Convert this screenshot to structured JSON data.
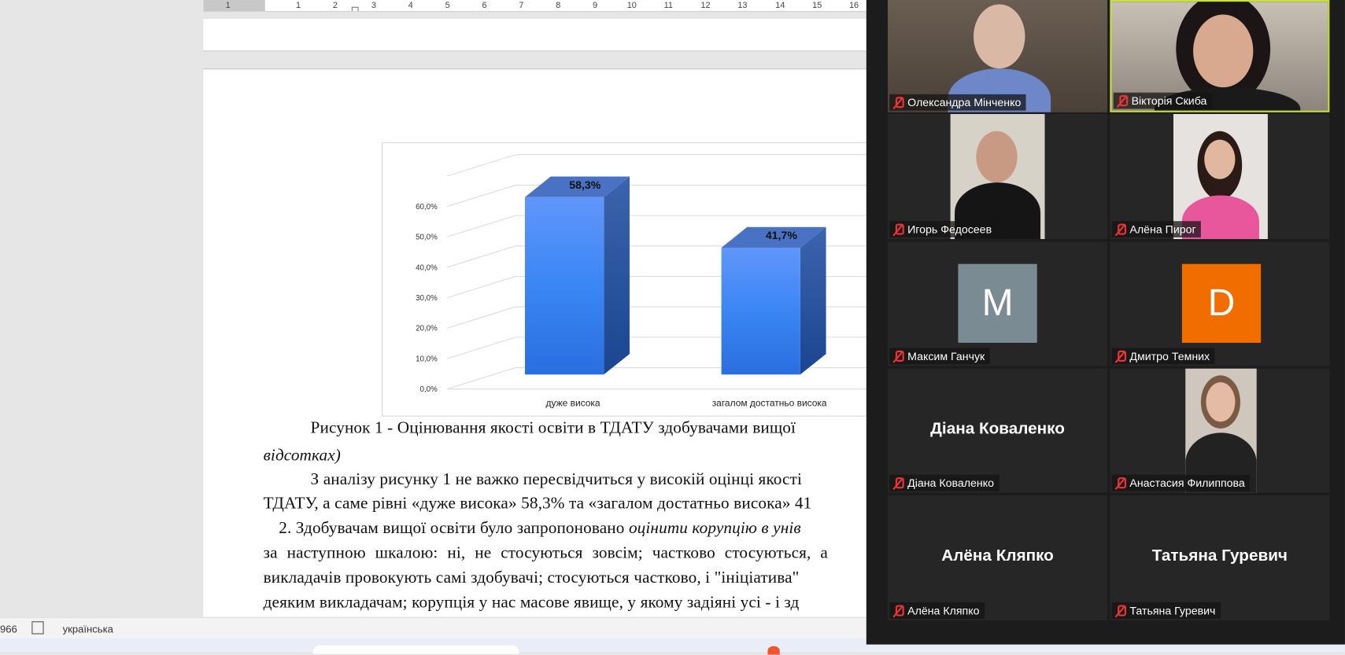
{
  "ruler": {
    "ticks": [
      "1",
      "1",
      "2",
      "3",
      "4",
      "5",
      "6",
      "7",
      "8",
      "9",
      "10",
      "11",
      "12",
      "13",
      "14",
      "15",
      "16"
    ]
  },
  "document": {
    "caption_line1": "Рисунок 1 - Оцінювання якості освіти в ТДАТУ здобувачами вищої",
    "caption_line2": "відсотках)",
    "para1_line1": "З аналізу рисунку 1 не важко пересвідчиться у високій оцінці якості",
    "para1_line2": "ТДАТУ, а саме рівні «дуже висока» 58,3% та «загалом достатньо висока» 41",
    "para2_line1_prefix": "2. Здобувачам вищої освіти було запропоновано ",
    "para2_line1_italic": "оцінити корупцію в унів",
    "para2_line2": "за наступною шкалою: ні, не стосуються зовсім; частково стосуються, а",
    "para2_line3": "викладачів провокують самі здобувачі; стосуються частково, і \"ініціатива\"",
    "para2_line4": "деяким викладачам; корупція у нас масове явище, у якому задіяні усі - і зд"
  },
  "chart_data": {
    "type": "bar",
    "style": "3d-column",
    "categories": [
      "дуже висока",
      "загалом достатньо висока"
    ],
    "values": [
      58.3,
      41.7
    ],
    "data_labels": [
      "58,3%",
      "41,7%"
    ],
    "yticks": [
      "0,0%",
      "10,0%",
      "20,0%",
      "30,0%",
      "40,0%",
      "50,0%",
      "60,0%"
    ],
    "ylim": [
      0,
      70
    ],
    "grid": true,
    "bar_color": "#3a86f5"
  },
  "statusbar": {
    "word_count": "966",
    "language": "українська"
  },
  "zoom": {
    "participants": [
      {
        "name": "Олександра Мінченко",
        "type": "video",
        "muted": true
      },
      {
        "name": "Вікторія Скиба",
        "type": "video",
        "muted": true,
        "active_speaker": true
      },
      {
        "name": "Игорь Федосеев",
        "type": "video",
        "muted": true
      },
      {
        "name": "Алёна Пирог",
        "type": "video",
        "muted": true
      },
      {
        "name": "Максим Ганчук",
        "type": "avatar",
        "initial": "M",
        "color": "#7b8b93",
        "muted": true
      },
      {
        "name": "Дмитро Темних",
        "type": "avatar",
        "initial": "D",
        "color": "#f26d00",
        "muted": true
      },
      {
        "name": "Діана Коваленко",
        "type": "name",
        "display": "Діана Коваленко",
        "muted": true
      },
      {
        "name": "Анастасия Филиппова",
        "type": "video",
        "muted": true
      },
      {
        "name": "Алёна Кляпко",
        "type": "name",
        "display": "Алёна Кляпко",
        "muted": true
      },
      {
        "name": "Татьяна Гуревич",
        "type": "name",
        "display": "Татьяна Гуревич",
        "muted": true
      }
    ]
  }
}
